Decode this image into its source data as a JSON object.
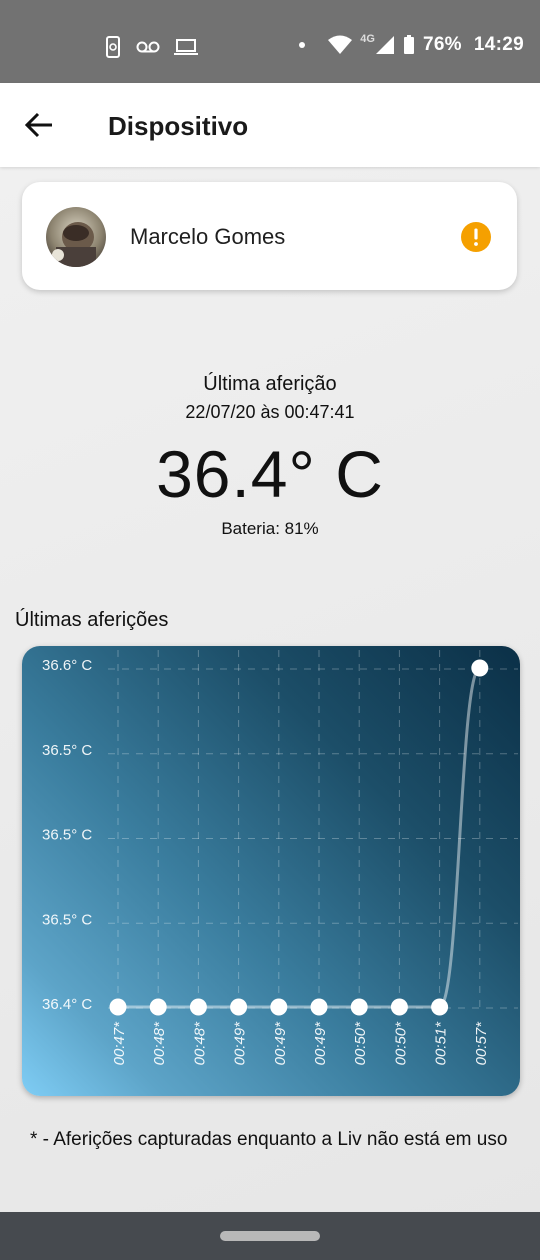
{
  "status_bar": {
    "network_label": "4G",
    "battery_percent": "76%",
    "time": "14:29"
  },
  "app_bar": {
    "title": "Dispositivo"
  },
  "user_card": {
    "name": "Marcelo Gomes",
    "alert_color": "#f5a000"
  },
  "last_reading": {
    "title": "Última aferição",
    "datetime": "22/07/20 às 00:47:41",
    "temperature": "36.4° C",
    "battery": "Bateria: 81%"
  },
  "history": {
    "title": "Últimas aferições"
  },
  "chart_data": {
    "type": "line",
    "y_tick_labels": [
      "36.6° C",
      "36.5° C",
      "36.5° C",
      "36.5° C",
      "36.4° C"
    ],
    "ylim": [
      36.4,
      36.6
    ],
    "categories": [
      "00:47*",
      "00:48*",
      "00:48*",
      "00:49*",
      "00:49*",
      "00:49*",
      "00:50*",
      "00:50*",
      "00:51*",
      "00:57*"
    ],
    "values": [
      36.4,
      36.4,
      36.4,
      36.4,
      36.4,
      36.4,
      36.4,
      36.4,
      36.4,
      36.6
    ],
    "grid": true,
    "point_color": "#ffffff"
  },
  "footnote": "* - Aferições capturadas enquanto a Liv não está em uso"
}
